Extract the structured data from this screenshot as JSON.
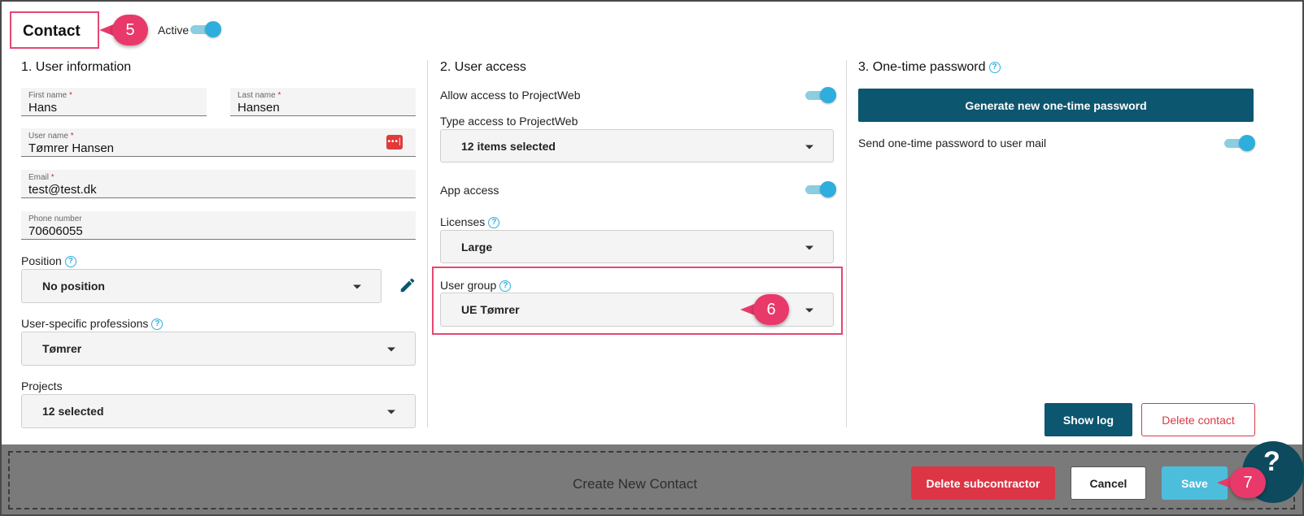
{
  "header": {
    "title": "Contact",
    "active_label": "Active",
    "active_on": true
  },
  "callouts": {
    "c5": "5",
    "c6": "6",
    "c7": "7"
  },
  "user_information": {
    "heading": "1. User information",
    "first_name": {
      "label": "First name",
      "required": "*",
      "value": "Hans"
    },
    "last_name": {
      "label": "Last name",
      "required": "*",
      "value": "Hansen"
    },
    "user_name": {
      "label": "User name",
      "required": "*",
      "value": "Tømrer Hansen",
      "icon": "password-dots-icon"
    },
    "email": {
      "label": "Email",
      "required": "*",
      "value": "test@test.dk"
    },
    "phone": {
      "label": "Phone number",
      "value": "70606055"
    },
    "position": {
      "label": "Position",
      "value": "No position"
    },
    "professions": {
      "label": "User-specific professions",
      "value": "Tømrer"
    },
    "projects": {
      "label": "Projects",
      "value": "12 selected"
    }
  },
  "user_access": {
    "heading": "2. User access",
    "allow_projectweb": {
      "label": "Allow access to ProjectWeb",
      "on": true
    },
    "type_access": {
      "label": "Type access to ProjectWeb",
      "value": "12 items selected"
    },
    "app_access": {
      "label": "App access",
      "on": true
    },
    "licenses": {
      "label": "Licenses",
      "value": "Large"
    },
    "user_group": {
      "label": "User group",
      "value": "UE Tømrer"
    }
  },
  "one_time_password": {
    "heading": "3. One-time password",
    "generate_label": "Generate new one-time password",
    "send_mail_label": "Send one-time password to user mail",
    "send_mail_on": true
  },
  "actions": {
    "show_log": "Show log",
    "delete_contact": "Delete contact"
  },
  "footer": {
    "title": "Create New Contact",
    "delete_subcontractor": "Delete subcontractor",
    "cancel": "Cancel",
    "save": "Save"
  },
  "help_fab": "?",
  "colors": {
    "accent": "#2eaedc",
    "primary": "#0d5670",
    "danger": "#dc3545",
    "callout": "#e8396a",
    "footer_bg": "#7a7a7a"
  }
}
